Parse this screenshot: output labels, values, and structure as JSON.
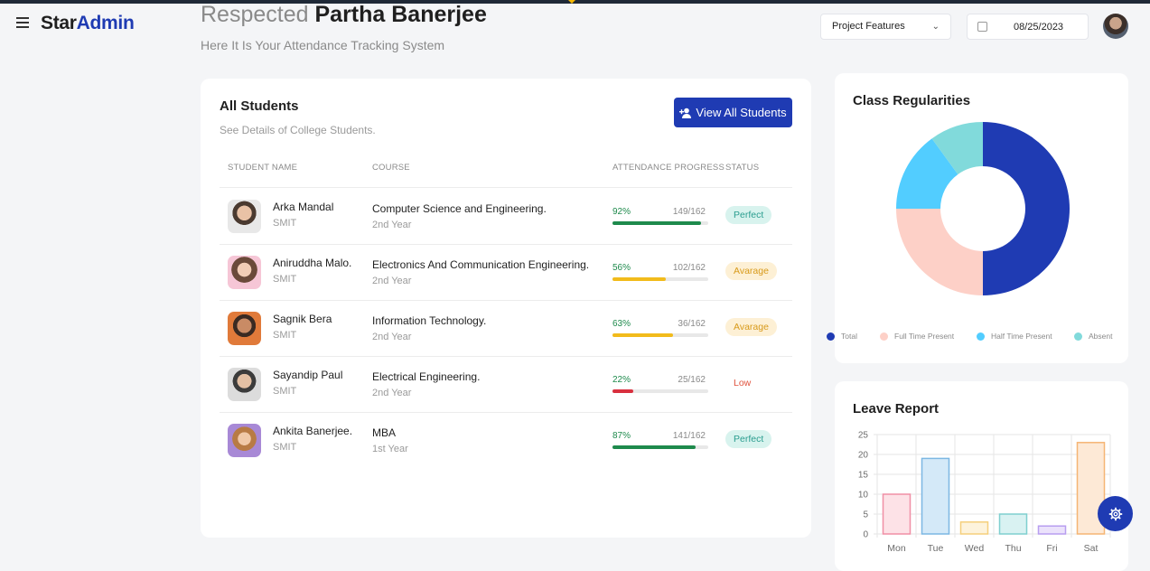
{
  "header": {
    "logo_part1": "Star",
    "logo_part2": "Admin",
    "greeting_prefix": "Respected",
    "user_name": "Partha Banerjee",
    "subtitle": "Here It Is Your Attendance Tracking System",
    "dropdown_label": "Project Features",
    "date": "08/25/2023"
  },
  "students": {
    "title": "All Students",
    "description": "See Details of College Students.",
    "view_all_label": "View All Students",
    "columns": [
      "STUDENT NAME",
      "COURSE",
      "ATTENDANCE PROGRESS",
      "STATUS"
    ],
    "rows": [
      {
        "name": "Arka Mandal",
        "org": "SMIT",
        "course": "Computer Science and Engineering.",
        "year": "2nd Year",
        "percent": "92%",
        "count": "149/162",
        "progress": 0.92,
        "status": "Perfect",
        "bar_color": "#1e8a4c",
        "pct_color": "#1e8a4c",
        "status_bg": "#d8f3ee",
        "status_color": "#2a9d8f"
      },
      {
        "name": "Aniruddha Malo.",
        "org": "SMIT",
        "course": "Electronics And Communication Engineering.",
        "year": "2nd Year",
        "percent": "56%",
        "count": "102/162",
        "progress": 0.56,
        "status": "Avarage",
        "bar_color": "#f2bb1b",
        "pct_color": "#1e8a4c",
        "status_bg": "#fdf0d5",
        "status_color": "#d89a1a"
      },
      {
        "name": "Sagnik Bera",
        "org": "SMIT",
        "course": "Information Technology.",
        "year": "2nd Year",
        "percent": "63%",
        "count": "36/162",
        "progress": 0.63,
        "status": "Avarage",
        "bar_color": "#f2bb1b",
        "pct_color": "#1e8a4c",
        "status_bg": "#fdf0d5",
        "status_color": "#d89a1a"
      },
      {
        "name": "Sayandip Paul",
        "org": "SMIT",
        "course": "Electrical Engineering.",
        "year": "2nd Year",
        "percent": "22%",
        "count": "25/162",
        "progress": 0.22,
        "status": "Low",
        "bar_color": "#d9303f",
        "pct_color": "#1e8a4c",
        "status_bg": "transparent",
        "status_color": "#e0533e"
      },
      {
        "name": "Ankita Banerjee.",
        "org": "SMIT",
        "course": "MBA",
        "year": "1st Year",
        "percent": "87%",
        "count": "141/162",
        "progress": 0.87,
        "status": "Perfect",
        "bar_color": "#1e8a4c",
        "pct_color": "#1e8a4c",
        "status_bg": "#d8f3ee",
        "status_color": "#2a9d8f"
      }
    ]
  },
  "class_regularities": {
    "title": "Class Regularities",
    "chart_data": {
      "type": "pie",
      "hole": true,
      "categories": [
        "Total",
        "Full Time Present",
        "Half Time Present",
        "Absent"
      ],
      "values": [
        50,
        25,
        15,
        10
      ],
      "colors": [
        "#1f3bb3",
        "#fdd0c7",
        "#52cdff",
        "#81dadb"
      ]
    }
  },
  "leave_report": {
    "title": "Leave Report",
    "chart_data": {
      "type": "bar",
      "categories": [
        "Mon",
        "Tue",
        "Wed",
        "Thu",
        "Fri",
        "Sat"
      ],
      "values": [
        10,
        19,
        3,
        5,
        2,
        23
      ],
      "ylim": [
        0,
        25
      ],
      "yticks": [
        0,
        5,
        10,
        15,
        20,
        25
      ],
      "fill_colors": [
        "#fde2e7",
        "#d4e9f8",
        "#fdf3dc",
        "#d9f2f2",
        "#ebe2fb",
        "#fde9d6"
      ],
      "stroke_colors": [
        "#f08fa6",
        "#7cb7e3",
        "#f5cf7c",
        "#7fcfcf",
        "#b89ef0",
        "#f5b574"
      ]
    }
  },
  "icons": {
    "menu": "hamburger-icon",
    "calendar": "calendar-icon",
    "add_user": "add-user-icon",
    "settings": "gear-icon"
  }
}
